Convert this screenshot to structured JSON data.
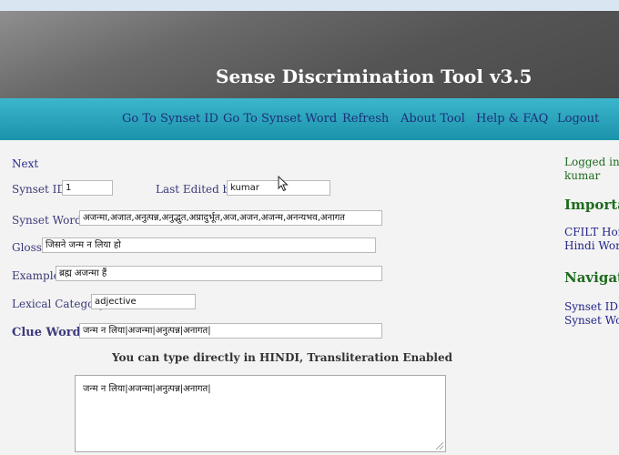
{
  "header": {
    "title": "Sense Discrimination Tool v3.5"
  },
  "nav": {
    "items": [
      {
        "label": "Go To Synset ID"
      },
      {
        "label": "Go To Synset Word"
      },
      {
        "label": "Refresh"
      },
      {
        "label": "About Tool"
      },
      {
        "label": "Help & FAQ"
      },
      {
        "label": "Logout"
      }
    ]
  },
  "form": {
    "next_link": "Next",
    "synset_id": {
      "label": "Synset ID:",
      "value": "1"
    },
    "last_edited": {
      "label": "Last Edited by:",
      "value": "kumar"
    },
    "synset_words": {
      "label": "Synset Words:",
      "value": "अजन्मा,अजात,अनुत्पन्न,अनुद्भुत,अप्रादुर्भूत,अज,अजन,अजन्म,अनन्यभव,अनागत"
    },
    "gloss": {
      "label": "Gloss:",
      "value": "जिसने जन्म न लिया हो"
    },
    "example": {
      "label": "Example:",
      "value": "ब्रह्म अजन्मा हैं"
    },
    "lexical_category": {
      "label": "Lexical Category:",
      "value": "adjective"
    },
    "clue_words": {
      "label": "Clue Words:",
      "value": "जन्म न लिया|अजन्मा|अनुत्पन्न|अनागत|"
    },
    "notice": "You can type directly in HINDI, Transliteration Enabled",
    "textarea_value": "जन्म न लिया|अजन्मा|अनुत्पन्न|अनागत|"
  },
  "sidebar": {
    "logged_in": "Logged in a",
    "user": "kumar",
    "important_heading": "Importa",
    "important_links": [
      "CFILT Hor",
      "Hindi Wor"
    ],
    "navigate_heading": "Navigat",
    "navigate_links": [
      "Synset ID",
      "Synset Wo"
    ]
  }
}
